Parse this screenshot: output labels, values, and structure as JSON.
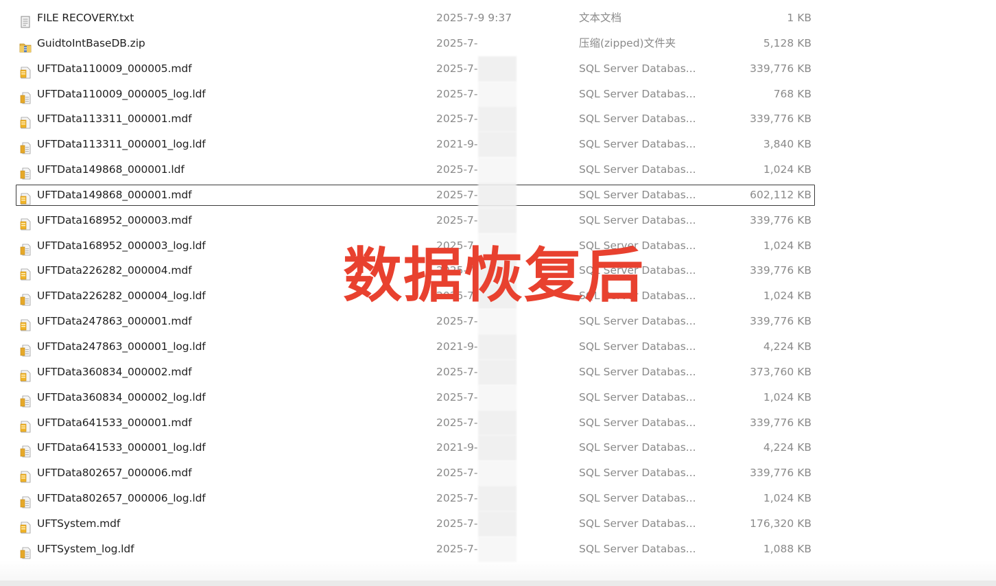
{
  "files": [
    {
      "name": "FILE RECOVERY.txt",
      "date": "2025-7-9 9:37",
      "type": "文本文档",
      "size": "1 KB",
      "icon": "txt"
    },
    {
      "name": "GuidtoIntBaseDB.zip",
      "date": "2025-7-",
      "type": "压缩(zipped)文件夹",
      "size": "5,128 KB",
      "icon": "zip"
    },
    {
      "name": "UFTData110009_000005.mdf",
      "date": "2025-7-",
      "type": "SQL Server Databas...",
      "size": "339,776 KB",
      "icon": "mdf"
    },
    {
      "name": "UFTData110009_000005_log.ldf",
      "date": "2025-7-",
      "type": "SQL Server Databas...",
      "size": "768 KB",
      "icon": "ldf"
    },
    {
      "name": "UFTData113311_000001.mdf",
      "date": "2025-7-",
      "type": "SQL Server Databas...",
      "size": "339,776 KB",
      "icon": "mdf"
    },
    {
      "name": "UFTData113311_000001_log.ldf",
      "date": "2021-9-",
      "type": "SQL Server Databas...",
      "size": "3,840 KB",
      "icon": "ldf"
    },
    {
      "name": "UFTData149868_000001.ldf",
      "date": "2025-7-",
      "type": "SQL Server Databas...",
      "size": "1,024 KB",
      "icon": "ldf"
    },
    {
      "name": "UFTData149868_000001.mdf",
      "date": "2025-7-",
      "type": "SQL Server Databas...",
      "size": "602,112 KB",
      "icon": "mdf",
      "selected": true
    },
    {
      "name": "UFTData168952_000003.mdf",
      "date": "2025-7-",
      "type": "SQL Server Databas...",
      "size": "339,776 KB",
      "icon": "mdf"
    },
    {
      "name": "UFTData168952_000003_log.ldf",
      "date": "2025-7-",
      "type": "SQL Server Databas...",
      "size": "1,024 KB",
      "icon": "ldf"
    },
    {
      "name": "UFTData226282_000004.mdf",
      "date": "2025-7-",
      "type": "SQL Server Databas...",
      "size": "339,776 KB",
      "icon": "mdf"
    },
    {
      "name": "UFTData226282_000004_log.ldf",
      "date": "2025-7-",
      "type": "SQL Server Databas...",
      "size": "1,024 KB",
      "icon": "ldf"
    },
    {
      "name": "UFTData247863_000001.mdf",
      "date": "2025-7-",
      "type": "SQL Server Databas...",
      "size": "339,776 KB",
      "icon": "mdf"
    },
    {
      "name": "UFTData247863_000001_log.ldf",
      "date": "2021-9-",
      "type": "SQL Server Databas...",
      "size": "4,224 KB",
      "icon": "ldf"
    },
    {
      "name": "UFTData360834_000002.mdf",
      "date": "2025-7-",
      "type": "SQL Server Databas...",
      "size": "373,760 KB",
      "icon": "mdf"
    },
    {
      "name": "UFTData360834_000002_log.ldf",
      "date": "2025-7-",
      "type": "SQL Server Databas...",
      "size": "1,024 KB",
      "icon": "ldf"
    },
    {
      "name": "UFTData641533_000001.mdf",
      "date": "2025-7-",
      "type": "SQL Server Databas...",
      "size": "339,776 KB",
      "icon": "mdf"
    },
    {
      "name": "UFTData641533_000001_log.ldf",
      "date": "2021-9-",
      "type": "SQL Server Databas...",
      "size": "4,224 KB",
      "icon": "ldf"
    },
    {
      "name": "UFTData802657_000006.mdf",
      "date": "2025-7-",
      "type": "SQL Server Databas...",
      "size": "339,776 KB",
      "icon": "mdf"
    },
    {
      "name": "UFTData802657_000006_log.ldf",
      "date": "2025-7-",
      "type": "SQL Server Databas...",
      "size": "1,024 KB",
      "icon": "ldf"
    },
    {
      "name": "UFTSystem.mdf",
      "date": "2025-7-",
      "type": "SQL Server Databas...",
      "size": "176,320 KB",
      "icon": "mdf"
    },
    {
      "name": "UFTSystem_log.ldf",
      "date": "2025-7-",
      "type": "SQL Server Databas...",
      "size": "1,088 KB",
      "icon": "ldf"
    }
  ],
  "overlay": {
    "text": "数据恢复后",
    "color": "#e8412f"
  }
}
